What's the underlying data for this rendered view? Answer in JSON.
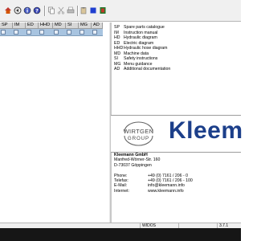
{
  "toolbar": {
    "icons": [
      "home-icon",
      "circle-arrow-icon",
      "info-icon",
      "help-icon",
      "copy-icon",
      "cut-icon",
      "print-icon",
      "paste-icon",
      "blue-square-icon",
      "close-book-icon"
    ]
  },
  "columns": [
    "SP",
    "IM",
    "ED",
    "HHD",
    "MD",
    "SI",
    "MG",
    "AD"
  ],
  "legend": [
    {
      "code": "SP",
      "text": "Spare parts catalogue"
    },
    {
      "code": "IM",
      "text": "Instruction manual"
    },
    {
      "code": "HD",
      "text": "Hydraulic diagram"
    },
    {
      "code": "ED",
      "text": "Electric diagram"
    },
    {
      "code": "HHD",
      "text": "Hydraulic hose diagram"
    },
    {
      "code": "MD",
      "text": "Machine data"
    },
    {
      "code": "SI",
      "text": "Safety instructions"
    },
    {
      "code": "MG",
      "text": "Menu guidance"
    },
    {
      "code": "AD",
      "text": "Additional documentation"
    }
  ],
  "logos": {
    "wirtgen_line1": "WIRTGEN",
    "wirtgen_line2": "GROUP",
    "kleemann": "Kleem"
  },
  "address": {
    "company": "Kleemann GmbH",
    "street": "Manfred-Wörner-Str. 160",
    "city": "D-73037 Göppingen",
    "contacts": [
      {
        "label": "Phone:",
        "value": "+49 (0) 7161 / 206 - 0"
      },
      {
        "label": "Telefax:",
        "value": "+49 (0) 7161 / 206 - 100"
      },
      {
        "label": "E-Mail:",
        "value": "info@kleemann.info"
      },
      {
        "label": "Internet:",
        "value": "www.kleemann.info"
      }
    ]
  },
  "statusbar": {
    "mode": "WIDOS",
    "version": "3.7.1"
  },
  "colors": {
    "selection": "#a8c4e0",
    "kleemann_blue": "#1c3f8a"
  }
}
